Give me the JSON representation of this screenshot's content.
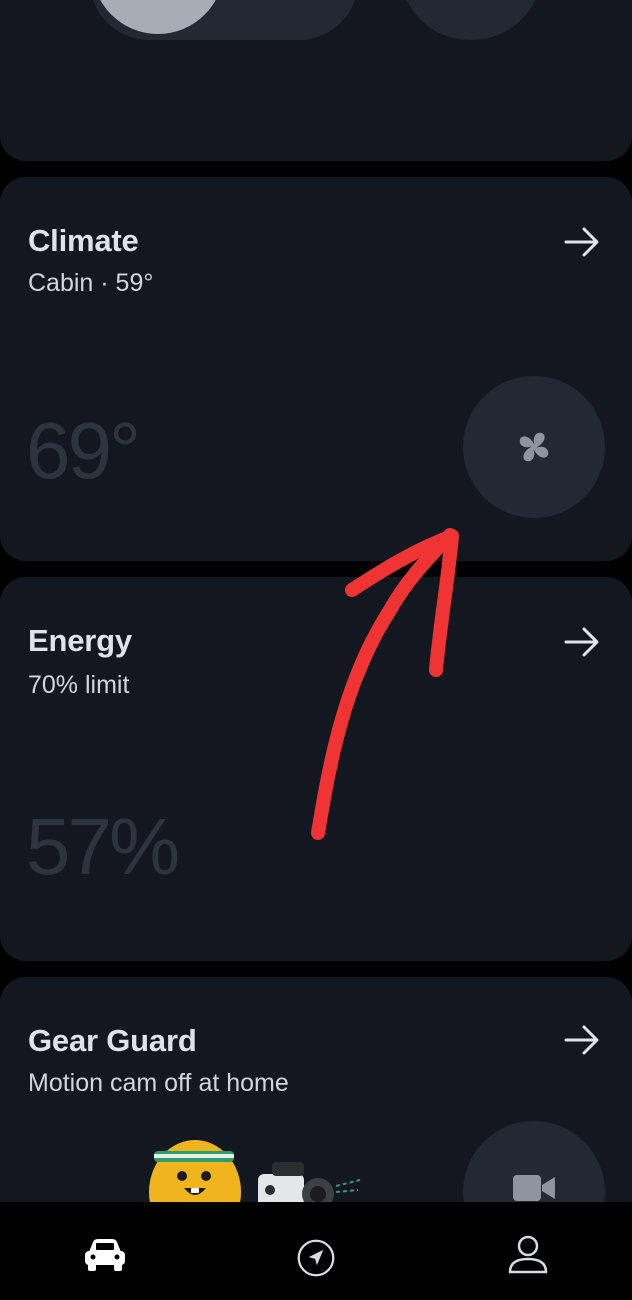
{
  "colors": {
    "background": "#000000",
    "card": "#131820",
    "button": "#222932",
    "active_lock": "#a7adb5",
    "muted_value": "#2d343d",
    "annotation": "#f03434"
  },
  "controls": {
    "lock_icon": "lock-icon",
    "unlock_icon": "unlock-icon",
    "apps_icon": "grid-icon"
  },
  "climate": {
    "title": "Climate",
    "subtitle": "Cabin · 59°",
    "value": "69°",
    "button_icon": "fan-icon"
  },
  "energy": {
    "title": "Energy",
    "subtitle": "70% limit",
    "value": "57%"
  },
  "gear_guard": {
    "title": "Gear Guard",
    "subtitle": "Motion cam off at home",
    "button_icon": "video-camera-icon"
  },
  "bottom_nav": {
    "items": [
      {
        "icon": "vehicle-icon",
        "active": true
      },
      {
        "icon": "navigation-icon",
        "active": false
      },
      {
        "icon": "profile-icon",
        "active": false
      }
    ]
  }
}
